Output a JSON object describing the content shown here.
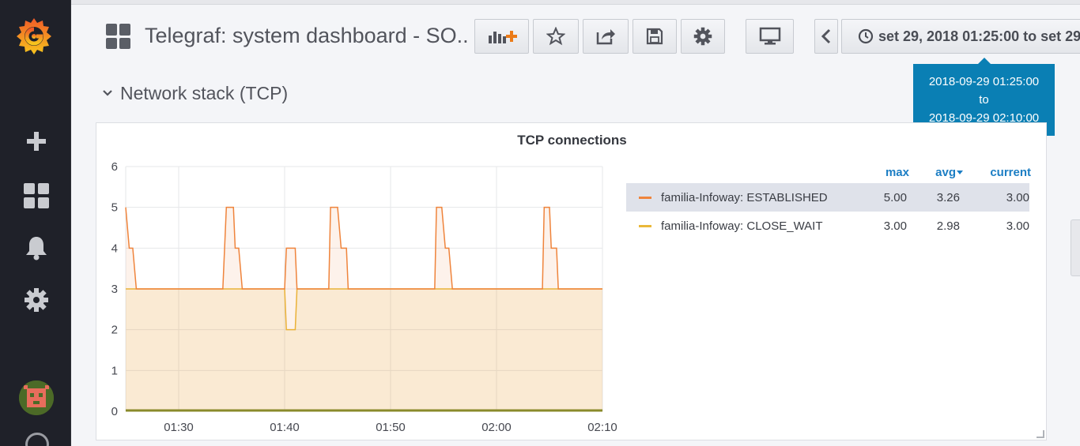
{
  "dashboard": {
    "title": "Telegraf: system dashboard - SO...",
    "time_range_label": "set 29, 2018 01:25:00 to set 29",
    "tooltip": {
      "from": "2018-09-29 01:25:00",
      "to_word": "to",
      "to": "2018-09-29 02:10:00"
    }
  },
  "toolbar": {
    "icons": [
      "add-panel-icon",
      "star-icon",
      "share-icon",
      "save-icon",
      "gear-icon",
      "monitor-icon",
      "chevron-left-icon",
      "clock-icon"
    ]
  },
  "sidebar": {
    "icons": [
      "grafana-logo",
      "plus-icon",
      "dashboards-icon",
      "bell-icon",
      "gear-icon",
      "avatar",
      "help-icon"
    ]
  },
  "row": {
    "title": "Network stack (TCP)"
  },
  "panel": {
    "title": "TCP connections",
    "legend": {
      "headers": {
        "max": "max",
        "avg": "avg",
        "current": "current"
      },
      "items": [
        {
          "name": "familia-Infoway: ESTABLISHED",
          "max": "5.00",
          "avg": "3.26",
          "current": "3.00",
          "color": "#ef843c"
        },
        {
          "name": "familia-Infoway: CLOSE_WAIT",
          "max": "3.00",
          "avg": "2.98",
          "current": "3.00",
          "color": "#eab839"
        }
      ]
    }
  },
  "chart_data": {
    "type": "area",
    "title": "TCP connections",
    "x_ticks": [
      "01:30",
      "01:40",
      "01:50",
      "02:00",
      "02:10"
    ],
    "y_ticks": [
      "0",
      "1",
      "2",
      "3",
      "4",
      "5",
      "6"
    ],
    "xlim": [
      "01:25",
      "02:10"
    ],
    "ylim": [
      0,
      6
    ],
    "grid": true,
    "legend_position": "right",
    "series": [
      {
        "name": "familia-Infoway: ESTABLISHED",
        "color": "#ef843c",
        "points": [
          [
            "01:25:00",
            5
          ],
          [
            "01:25:20",
            4
          ],
          [
            "01:25:40",
            4
          ],
          [
            "01:26:00",
            3
          ],
          [
            "01:34:10",
            3
          ],
          [
            "01:34:30",
            5
          ],
          [
            "01:35:10",
            5
          ],
          [
            "01:35:20",
            4
          ],
          [
            "01:35:40",
            4
          ],
          [
            "01:36:00",
            3
          ],
          [
            "01:40:00",
            3
          ],
          [
            "01:40:10",
            4
          ],
          [
            "01:41:00",
            4
          ],
          [
            "01:41:10",
            3
          ],
          [
            "01:44:10",
            3
          ],
          [
            "01:44:20",
            5
          ],
          [
            "01:45:00",
            5
          ],
          [
            "01:45:20",
            4
          ],
          [
            "01:45:50",
            4
          ],
          [
            "01:46:00",
            3
          ],
          [
            "01:54:10",
            3
          ],
          [
            "01:54:20",
            5
          ],
          [
            "01:54:50",
            5
          ],
          [
            "01:55:10",
            4
          ],
          [
            "01:55:30",
            4
          ],
          [
            "01:55:50",
            3
          ],
          [
            "02:04:20",
            3
          ],
          [
            "02:04:30",
            5
          ],
          [
            "02:05:00",
            5
          ],
          [
            "02:05:10",
            4
          ],
          [
            "02:05:40",
            4
          ],
          [
            "02:05:50",
            3
          ],
          [
            "02:10:00",
            3
          ]
        ]
      },
      {
        "name": "familia-Infoway: CLOSE_WAIT",
        "color": "#eab839",
        "points": [
          [
            "01:25:00",
            3
          ],
          [
            "01:40:00",
            3
          ],
          [
            "01:40:10",
            2
          ],
          [
            "01:41:00",
            2
          ],
          [
            "01:41:10",
            3
          ],
          [
            "02:10:00",
            3
          ]
        ]
      }
    ]
  }
}
